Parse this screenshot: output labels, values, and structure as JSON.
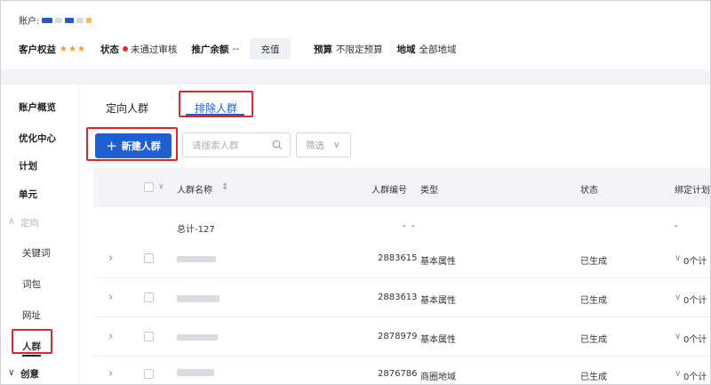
{
  "header": {
    "account_label": "账户:",
    "rights_label": "客户权益",
    "rights_stars": "★★★",
    "status_label": "状态",
    "status_value": "未通过审核",
    "balance_label": "推广余额",
    "balance_value": "--",
    "recharge_label": "充值",
    "budget_label": "预算",
    "budget_value": "不限定预算",
    "region_label": "地域",
    "region_value": "全部地域"
  },
  "sidebar": {
    "items": [
      {
        "label": "账户概览"
      },
      {
        "label": "优化中心"
      },
      {
        "label": "计划"
      },
      {
        "label": "单元"
      },
      {
        "label": "定向"
      },
      {
        "label": "关键词"
      },
      {
        "label": "词包"
      },
      {
        "label": "网址"
      },
      {
        "label": "人群"
      },
      {
        "label": "创意"
      }
    ],
    "collapse_glyph": "∧",
    "expand_glyph": "∨"
  },
  "tabs": [
    {
      "label": "定向人群"
    },
    {
      "label": "排除人群"
    }
  ],
  "toolbar": {
    "new_button": "新建人群",
    "plus": "+",
    "search_placeholder": "请搜索人群",
    "filter_label": "筛选",
    "filter_arrow": "∨"
  },
  "table": {
    "headers": {
      "name": "人群名称",
      "sort": "⇕",
      "id": "人群编号",
      "type": "类型",
      "status": "状态",
      "plan": "绑定计划"
    },
    "summary": {
      "name": "总计-127",
      "id": "-",
      "type": "-",
      "plan": "-"
    },
    "rows": [
      {
        "id": "2883615",
        "type": "基本属性",
        "status": "已生成",
        "plan": "0个计"
      },
      {
        "id": "2883613",
        "type": "基本属性",
        "status": "已生成",
        "plan": "0个计"
      },
      {
        "id": "2878979",
        "type": "基本属性",
        "status": "已生成",
        "plan": "0个计"
      },
      {
        "id": "2876786",
        "type": "商圈地域",
        "status": "已生成",
        "plan": "0个计"
      }
    ],
    "expand_glyph": "›",
    "plan_arrow": "∨"
  },
  "colors": {
    "accent": "#1f5fd1",
    "highlight": "#e0262b",
    "star": "#f0a020",
    "status_dot": "#e03131"
  }
}
